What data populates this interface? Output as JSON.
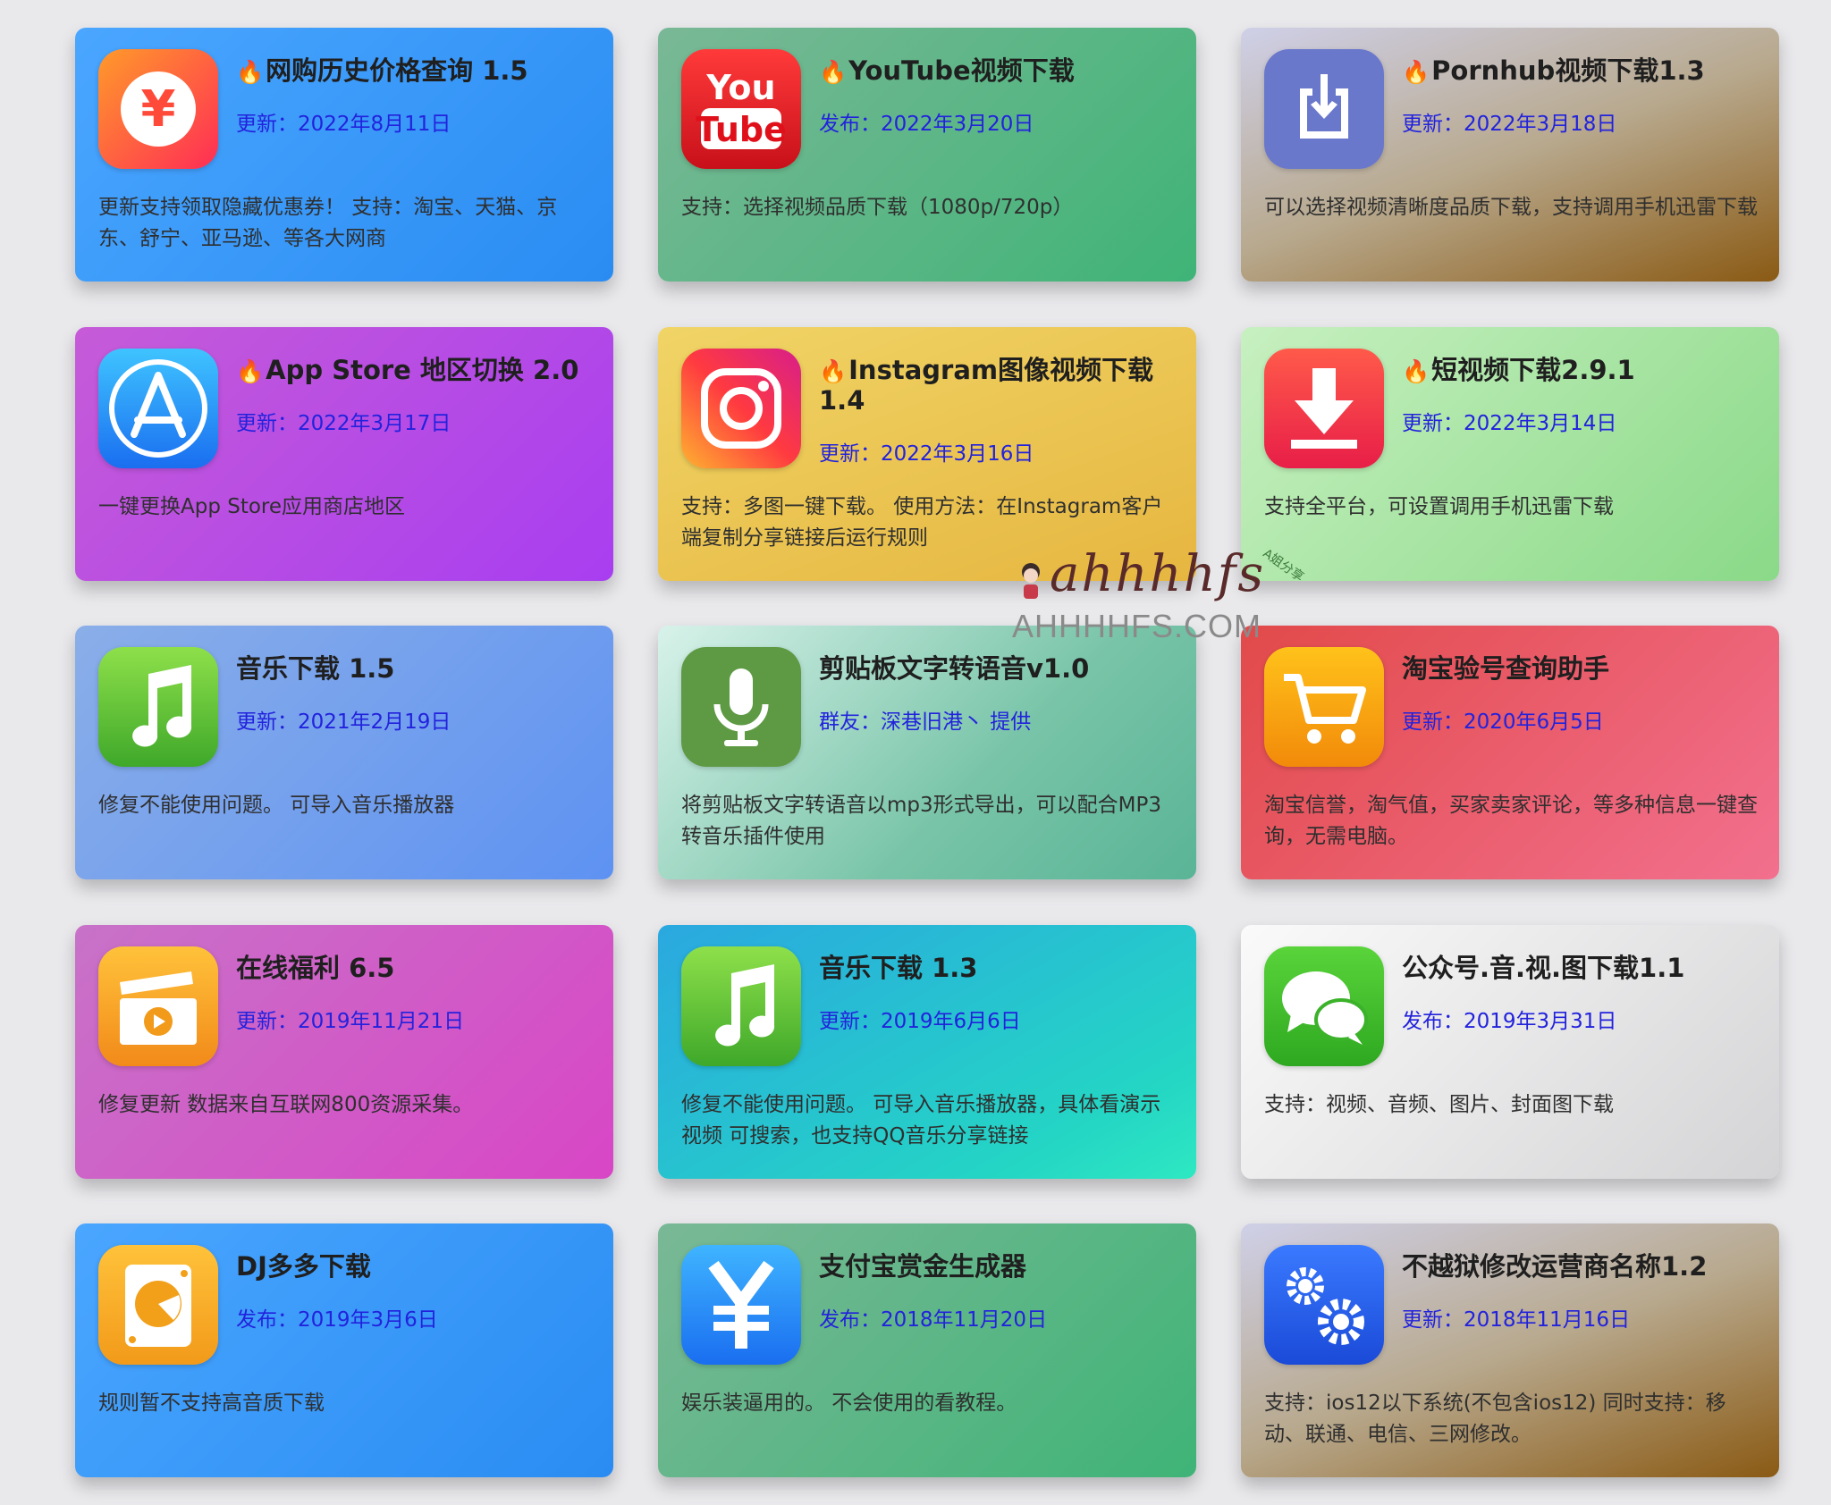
{
  "cards": [
    {
      "icon": "yen-coin-icon",
      "fire": "🔥",
      "title": "网购历史价格查询 1.5",
      "meta": "更新：2022年8月11日",
      "desc": "更新支持领取隐藏优惠券！ 支持：淘宝、天猫、京东、舒宁、亚马逊、等各大网商"
    },
    {
      "icon": "youtube-icon",
      "fire": "🔥",
      "title": "YouTube视频下载",
      "meta": "发布：2022年3月20日",
      "desc": "支持：选择视频品质下载（1080p/720p）",
      "icon_text_1": "You",
      "icon_text_2": "Tube"
    },
    {
      "icon": "download-tray-icon",
      "fire": "🔥",
      "title": "Pornhub视频下载1.3",
      "meta": "更新：2022年3月18日",
      "desc": "可以选择视频清晰度品质下载，支持调用手机迅雷下载"
    },
    {
      "icon": "app-store-icon",
      "fire": "🔥",
      "title": "App Store 地区切换 2.0",
      "meta": "更新：2022年3月17日",
      "desc": "一键更换App Store应用商店地区"
    },
    {
      "icon": "instagram-icon",
      "fire": "🔥",
      "title": "Instagram图像视频下载1.4",
      "meta": "更新：2022年3月16日",
      "desc": "支持：多图一键下载。 使用方法：在Instagram客户端复制分享链接后运行规则"
    },
    {
      "icon": "download-arrow-icon",
      "fire": "🔥",
      "title": "短视频下载2.9.1",
      "meta": "更新：2022年3月14日",
      "desc": "支持全平台，可设置调用手机迅雷下载"
    },
    {
      "icon": "music-note-icon",
      "fire": "",
      "title": "音乐下载 1.5",
      "meta": "更新：2021年2月19日",
      "desc": "修复不能使用问题。 可导入音乐播放器"
    },
    {
      "icon": "microphone-icon",
      "fire": "",
      "title": "剪贴板文字转语音v1.0",
      "meta": "群友：深巷旧港丶 提供",
      "desc": "将剪贴板文字转语音以mp3形式导出，可以配合MP3转音乐插件使用"
    },
    {
      "icon": "shopping-cart-icon",
      "fire": "",
      "title": "淘宝验号查询助手",
      "meta": "更新：2020年6月5日",
      "desc": "淘宝信誉，淘气值，买家卖家评论，等多种信息一键查询，无需电脑。"
    },
    {
      "icon": "video-clapper-icon",
      "fire": "",
      "title": "在线福利 6.5",
      "meta": "更新：2019年11月21日",
      "desc": "修复更新 数据来自互联网800资源采集。"
    },
    {
      "icon": "music-note-icon",
      "fire": "",
      "title": "音乐下载 1.3",
      "meta": "更新：2019年6月6日",
      "desc": "修复不能使用问题。 可导入音乐播放器，具体看演示视频 可搜索，也支持QQ音乐分享链接"
    },
    {
      "icon": "chat-bubbles-icon",
      "fire": "",
      "title": "公众号.音.视.图下载1.1",
      "meta": "发布：2019年3月31日",
      "desc": "支持：视频、音频、图片、封面图下载"
    },
    {
      "icon": "disk-icon",
      "fire": "",
      "title": "DJ多多下载",
      "meta": "发布：2019年3月6日",
      "desc": "规则暂不支持高音质下载"
    },
    {
      "icon": "yen-icon",
      "fire": "",
      "title": "支付宝赏金生成器",
      "meta": "发布：2018年11月20日",
      "desc": "娱乐装逼用的。 不会使用的看教程。"
    },
    {
      "icon": "gears-icon",
      "fire": "",
      "title": "不越狱修改运营商名称1.2",
      "meta": "更新：2018年11月16日",
      "desc": "支持：ios12以下系统(不包含ios12) 同时支持：移动、联通、电信、三网修改。"
    }
  ],
  "watermark": {
    "script": "ahhhhfs",
    "domain": "AHHHHFS.COM",
    "tag": "A姐分享"
  },
  "colors": {
    "background": "#e9e9ec",
    "meta_text": "#2222dd",
    "title_text": "#1f1f1f"
  }
}
